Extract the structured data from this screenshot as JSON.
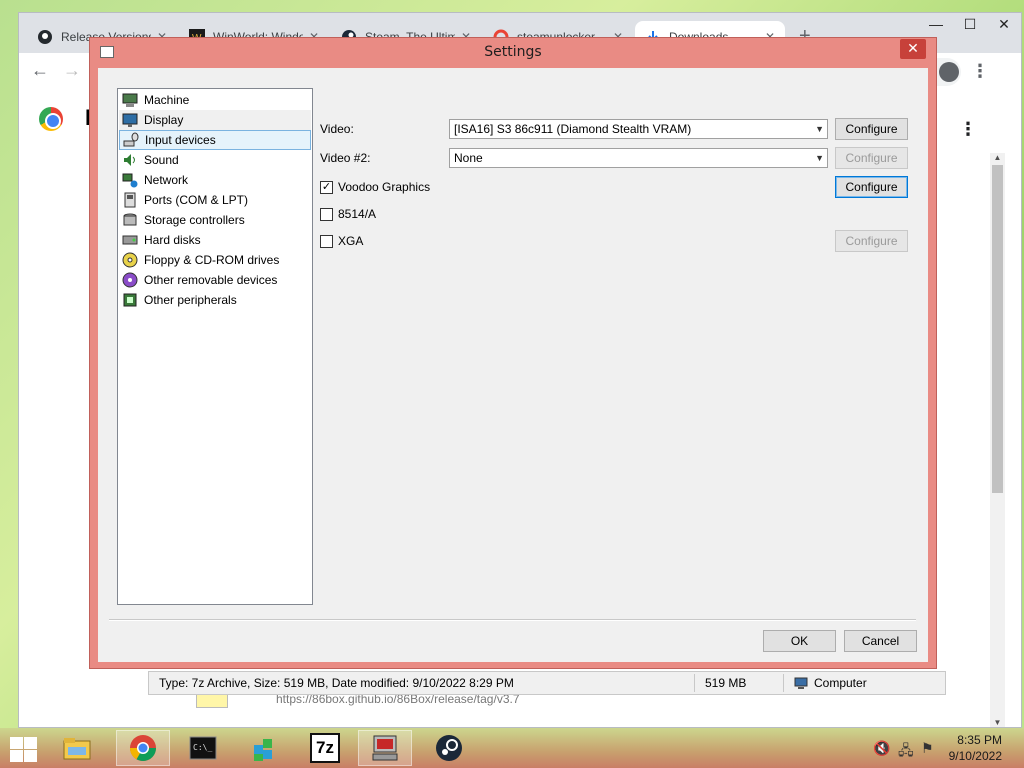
{
  "chrome": {
    "tabs": [
      {
        "title": "Release Versions"
      },
      {
        "title": "WinWorld: Windows"
      },
      {
        "title": "Steam, The Ultimate"
      },
      {
        "title": "steamunlocker"
      },
      {
        "title": "Downloads"
      }
    ],
    "page_initial": "D"
  },
  "explorer_status": {
    "info": "Type: 7z Archive, Size: 519 MB, Date modified: 9/10/2022 8:29 PM",
    "size": "519 MB",
    "location": "Computer",
    "url_fragment": "https://86box.github.io/86Box/release/tag/v3.7"
  },
  "dialog": {
    "title": "Settings",
    "tree": [
      {
        "label": "Machine",
        "icon": "machine-icon"
      },
      {
        "label": "Display",
        "icon": "display-icon"
      },
      {
        "label": "Input devices",
        "icon": "input-devices-icon"
      },
      {
        "label": "Sound",
        "icon": "sound-icon"
      },
      {
        "label": "Network",
        "icon": "network-icon"
      },
      {
        "label": "Ports (COM & LPT)",
        "icon": "ports-icon"
      },
      {
        "label": "Storage controllers",
        "icon": "storage-icon"
      },
      {
        "label": "Hard disks",
        "icon": "hard-disk-icon"
      },
      {
        "label": "Floppy & CD-ROM drives",
        "icon": "floppy-cdrom-icon"
      },
      {
        "label": "Other removable devices",
        "icon": "removable-icon"
      },
      {
        "label": "Other peripherals",
        "icon": "peripherals-icon"
      }
    ],
    "video_label": "Video:",
    "video_value": "[ISA16] S3 86c911 (Diamond Stealth VRAM)",
    "video2_label": "Video #2:",
    "video2_value": "None",
    "voodoo_label": "Voodoo Graphics",
    "voodoo_checked": true,
    "ibm8514_label": "8514/A",
    "ibm8514_checked": false,
    "xga_label": "XGA",
    "xga_checked": false,
    "configure_label": "Configure",
    "ok_label": "OK",
    "cancel_label": "Cancel",
    "check_mark": "✓"
  },
  "taskbar": {
    "apps": [
      "file-explorer-icon",
      "chrome-icon",
      "cmd-icon",
      "registry-icon",
      "7zip-icon",
      "86box-icon",
      "steam-icon"
    ],
    "seven_zip_label": "7z",
    "time": "8:35 PM",
    "date": "9/10/2022"
  },
  "colors": {
    "dialog_frame": "#e98b84",
    "selection": "#e5f3fb",
    "taskbar": "#c9a06c"
  }
}
